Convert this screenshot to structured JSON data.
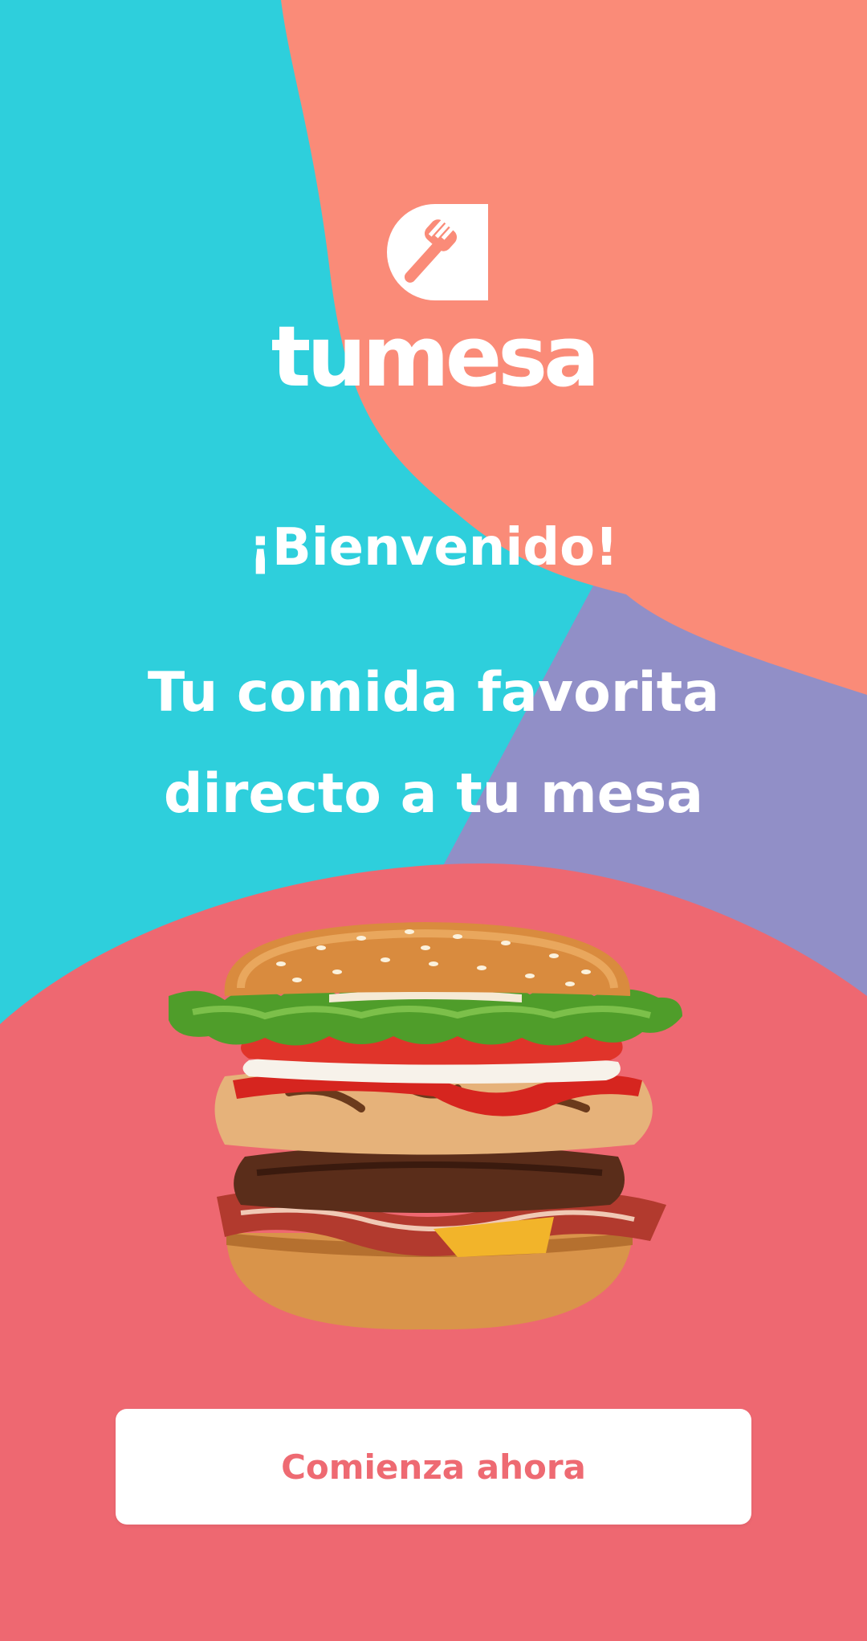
{
  "brand": {
    "name": "tumesa",
    "logo_icon": "fork-logo-icon"
  },
  "hero": {
    "welcome": "¡Bienvenido!",
    "tagline_line1": "Tu comida favorita",
    "tagline_line2": "directo a tu mesa",
    "image": "hamburger-photo"
  },
  "cta": {
    "label": "Comienza ahora"
  },
  "colors": {
    "cyan": "#2ecfdc",
    "salmon": "#fa8b78",
    "lavender": "#918fc7",
    "coral": "#ee6871",
    "white": "#ffffff"
  }
}
